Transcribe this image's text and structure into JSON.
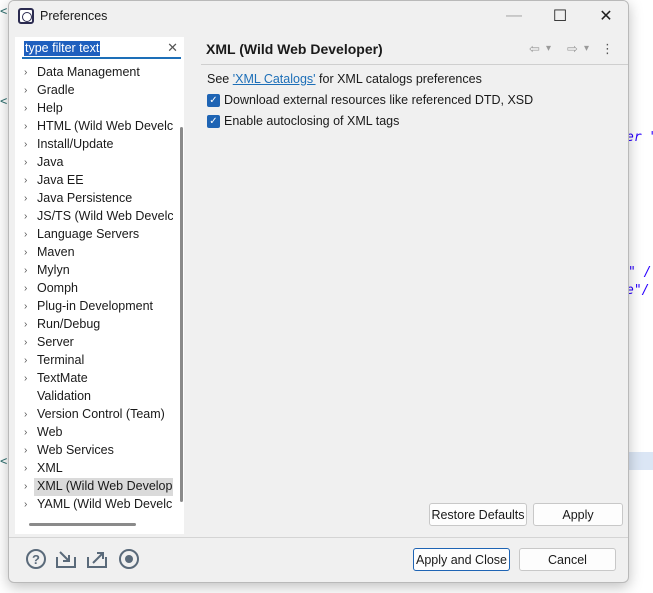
{
  "background": {
    "fragments": [
      "er \"",
      "\" /",
      "e\"/"
    ]
  },
  "dialog": {
    "title": "Preferences",
    "window_controls": {
      "minimize": "—",
      "maximize": "☐",
      "close": "✕"
    }
  },
  "filter": {
    "value": "type filter text",
    "clear_glyph": "✕"
  },
  "tree": {
    "arrow": "›",
    "items": [
      {
        "label": "Data Management",
        "expandable": true
      },
      {
        "label": "Gradle",
        "expandable": true
      },
      {
        "label": "Help",
        "expandable": true
      },
      {
        "label": "HTML (Wild Web Develc",
        "expandable": true
      },
      {
        "label": "Install/Update",
        "expandable": true
      },
      {
        "label": "Java",
        "expandable": true
      },
      {
        "label": "Java EE",
        "expandable": true
      },
      {
        "label": "Java Persistence",
        "expandable": true
      },
      {
        "label": "JS/TS (Wild Web Develc",
        "expandable": true
      },
      {
        "label": "Language Servers",
        "expandable": true
      },
      {
        "label": "Maven",
        "expandable": true
      },
      {
        "label": "Mylyn",
        "expandable": true
      },
      {
        "label": "Oomph",
        "expandable": true
      },
      {
        "label": "Plug-in Development",
        "expandable": true
      },
      {
        "label": "Run/Debug",
        "expandable": true
      },
      {
        "label": "Server",
        "expandable": true
      },
      {
        "label": "Terminal",
        "expandable": true
      },
      {
        "label": "TextMate",
        "expandable": true
      },
      {
        "label": "Validation",
        "expandable": false
      },
      {
        "label": "Version Control (Team)",
        "expandable": true
      },
      {
        "label": "Web",
        "expandable": true
      },
      {
        "label": "Web Services",
        "expandable": true
      },
      {
        "label": "XML",
        "expandable": true
      },
      {
        "label": "XML (Wild Web Develop",
        "expandable": true,
        "selected": true
      },
      {
        "label": "YAML (Wild Web Develc",
        "expandable": true
      }
    ]
  },
  "page": {
    "title": "XML (Wild Web Developer)",
    "nav": {
      "back": "⇦",
      "back_menu": "▾",
      "forward": "⇨",
      "forward_menu": "▾",
      "more": "⋮"
    },
    "see_prefix": "See ",
    "see_link": "'XML Catalogs'",
    "see_suffix": " for XML catalogs preferences",
    "options": [
      {
        "label": "Download external resources like referenced DTD, XSD",
        "checked": true
      },
      {
        "label": "Enable autoclosing of XML tags",
        "checked": true
      }
    ],
    "check_glyph": "✓",
    "restore_defaults": "Restore Defaults",
    "apply": "Apply"
  },
  "footer": {
    "help_glyph": "?",
    "icons": [
      "help-icon",
      "import-icon",
      "export-icon",
      "record-icon"
    ],
    "apply_and_close": "Apply and Close",
    "cancel": "Cancel"
  }
}
